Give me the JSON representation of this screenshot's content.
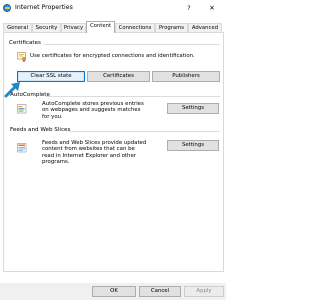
{
  "window": {
    "title": "Internet Properties",
    "help": "?",
    "close": "✕"
  },
  "tabs": [
    {
      "label": "General"
    },
    {
      "label": "Security"
    },
    {
      "label": "Privacy"
    },
    {
      "label": "Content"
    },
    {
      "label": "Connections"
    },
    {
      "label": "Programs"
    },
    {
      "label": "Advanced"
    }
  ],
  "certificates": {
    "heading": "Certificates",
    "description": "Use certificates for encrypted connections and identification.",
    "clear_ssl": "Clear SSL state",
    "certificates_btn": "Certificates",
    "publishers_btn": "Publishers"
  },
  "autocomplete": {
    "heading": "AutoComplete",
    "description_lines": [
      "AutoComplete stores previous entries",
      "on webpages and suggests matches",
      "for you."
    ],
    "settings_btn": "Settings"
  },
  "feeds": {
    "heading": "Feeds and Web Slices",
    "description_lines": [
      "Feeds and Web Slices provide updated",
      "content from websites that can be",
      "read in Internet Explorer and other",
      "programs."
    ],
    "settings_btn": "Settings"
  },
  "footer": {
    "ok": "OK",
    "cancel": "Cancel",
    "apply": "Apply"
  },
  "colors": {
    "accent": "#0078d7",
    "arrow": "#1e88c9"
  }
}
